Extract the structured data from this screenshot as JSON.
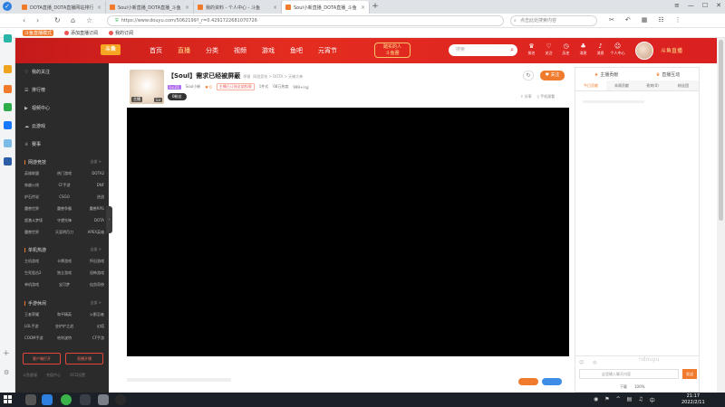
{
  "browser": {
    "tabs": [
      {
        "label": "DOTA直播_DOTA直播网站排行",
        "active": false
      },
      {
        "label": "Soul小新直播_DOTA直播_斗鱼",
        "active": false
      },
      {
        "label": "我的资料 - 个人中心 - 斗鱼",
        "active": false
      },
      {
        "label": "Soul小新直播_DOTA直播_斗鱼",
        "active": true
      }
    ],
    "url": "https://www.douyu.com/5062199?_r=0.4291722681070726",
    "search_placeholder": "点击此处搜索内容",
    "bookmarks": [
      "斗鱼直播模式",
      "添加直播订阅",
      "我的订阅"
    ]
  },
  "header": {
    "logo": "斗鱼",
    "nav": [
      {
        "label": "首页",
        "active": false
      },
      {
        "label": "直播",
        "active": true
      },
      {
        "label": "分类",
        "active": false
      },
      {
        "label": "视频",
        "active": false
      },
      {
        "label": "游戏",
        "active": false
      },
      {
        "label": "鱼吧",
        "active": false
      },
      {
        "label": "元宵节",
        "active": false
      }
    ],
    "promo_line1": "踏实的人",
    "promo_line2": "斗鱼圈",
    "search_placeholder": "搜索",
    "icons": [
      {
        "icon": "crown-icon",
        "label": "排名"
      },
      {
        "icon": "heart-icon",
        "label": "关注"
      },
      {
        "icon": "clock-icon",
        "label": "历史"
      },
      {
        "icon": "gift-icon",
        "label": "消息"
      },
      {
        "icon": "bell-icon",
        "label": "消息"
      },
      {
        "icon": "user-icon",
        "label": "个人中心"
      }
    ],
    "slogan": "斗鱼直播"
  },
  "menu": {
    "top_items": [
      {
        "icon": "heart-icon",
        "label": "我的关注"
      },
      {
        "icon": "list-icon",
        "label": "排行榜"
      },
      {
        "icon": "video-icon",
        "label": "视频中心"
      },
      {
        "icon": "cloud-icon",
        "label": "云游戏"
      },
      {
        "icon": "trophy-icon",
        "label": "赛事"
      }
    ],
    "sections": [
      {
        "title": "网游竞技",
        "more": "全部 >",
        "items": [
          "英雄联盟",
          "热门游戏",
          "DOTA2",
          "穿越火线",
          "CF手游",
          "DNF",
          "炉石传说",
          "CSGO",
          "逆战",
          "魔兽世界",
          "魔兽争霸",
          "魔兽RPG",
          "超激斗梦境",
          "守望先锋",
          "DOTA",
          "魔兽世界",
          "天涯明月刀",
          "APEX英雄"
        ]
      },
      {
        "title": "单机热游",
        "more": "全部 >",
        "items": [
          "主机游戏",
          "卡牌游戏",
          "怀旧游戏",
          "生死狙击2",
          "独立游戏",
          "恐怖游戏",
          "单机游戏",
          "宝可梦",
          "仙剑奇侠"
        ]
      },
      {
        "title": "手游休闲",
        "more": "全部 >",
        "items": [
          "王者荣耀",
          "和平精英",
          "火影忍者",
          "LOL手游",
          "金铲铲之战",
          "幻塔",
          "CODM手游",
          "哈利波特",
          "CF手游"
        ]
      }
    ],
    "buttons": [
      "客户端打开",
      "直播开播"
    ],
    "footer": [
      "斗鱼客服",
      "充值中心",
      "OCD设置"
    ]
  },
  "room": {
    "title": "【Soul】需求已经被屏蔽",
    "report": "举报",
    "breadcrumb": "网游竞技 > DOTA > 天梯大神",
    "level_badge": "Lv.21",
    "streamer": "Soul小新",
    "hot_count": "0",
    "warn_tag": "主播已订阅全部权限",
    "stat1": "1件式",
    "stat2": "68万热度",
    "stat3": "999+ing",
    "fans_pill": "0粉丝",
    "avatar_badge1": "主播",
    "avatar_badge2": "Lv",
    "follow_label": "关注",
    "share": "分享",
    "phone_watch": "手机观看"
  },
  "right_panel": {
    "header": [
      {
        "icon": "star-icon",
        "label": "主播贡献"
      },
      {
        "icon": "crown-icon",
        "label": "直播互动"
      }
    ],
    "tabs": [
      {
        "label": "今日贡献",
        "active": true
      },
      {
        "label": "本周贡献",
        "active": false
      },
      {
        "label": "贵宾(0)",
        "active": false
      },
      {
        "label": "粉丝团",
        "active": false
      }
    ],
    "input_placeholder": "这里输入聊天内容",
    "send_label": "发送",
    "watermark": "ndouyu"
  },
  "status": [
    "下载",
    "100%"
  ],
  "taskbar": {
    "time": "21:17",
    "date": "2022/2/11",
    "lang": "中"
  }
}
